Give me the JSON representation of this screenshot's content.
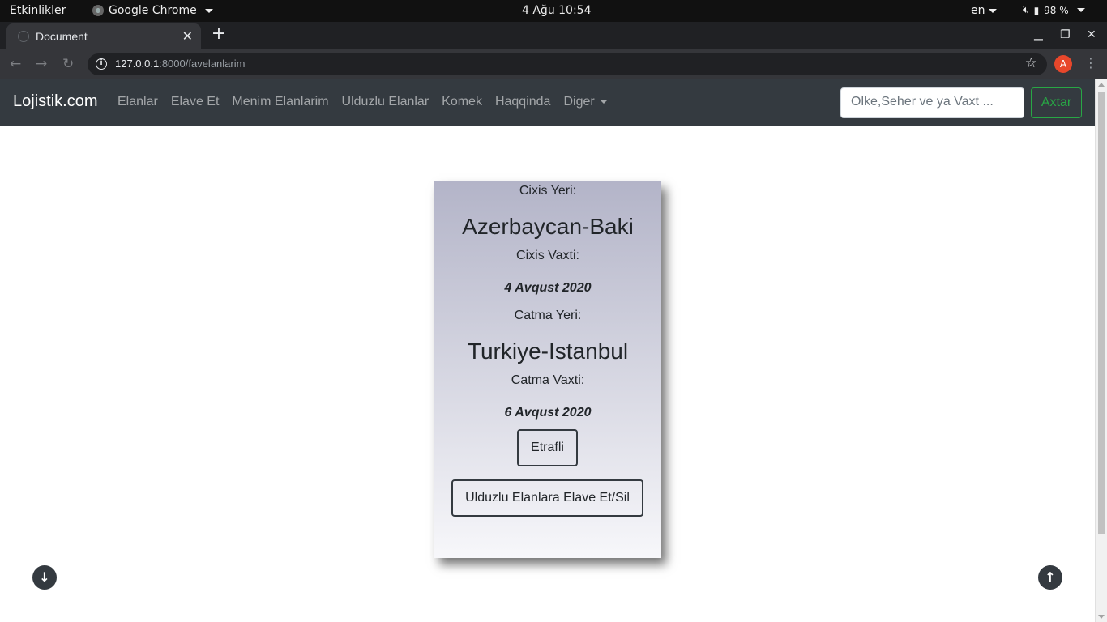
{
  "system_bar": {
    "activities": "Etkinlikler",
    "app_name": "Google Chrome",
    "clock": "4 Ağu  10:54",
    "language": "en",
    "battery": "98 %"
  },
  "browser": {
    "tab_title": "Document",
    "url_host": "127.0.0.1",
    "url_rest": ":8000/favelanlarim",
    "profile_initial": "A"
  },
  "navbar": {
    "brand": "Lojistik.com",
    "links": [
      "Elanlar",
      "Elave Et",
      "Menim Elanlarim",
      "Ulduzlu Elanlar",
      "Komek",
      "Haqqinda",
      "Diger"
    ],
    "search_placeholder": "Olke,Seher ve ya Vaxt ...",
    "search_button": "Axtar"
  },
  "card": {
    "departure_label": "Cixis Yeri:",
    "departure_place": "Azerbaycan-Baki",
    "departure_time_label": "Cixis Vaxti:",
    "departure_date": "4 Avqust 2020",
    "arrival_label": "Catma Yeri:",
    "arrival_place": "Turkiye-Istanbul",
    "arrival_time_label": "Catma Vaxti:",
    "arrival_date": "6 Avqust 2020",
    "details_button": "Etrafli",
    "favorite_button": "Ulduzlu Elanlara Elave Et/Sil"
  },
  "icons": {
    "scroll_down": "arrow-down-icon",
    "scroll_up": "arrow-up-icon"
  }
}
